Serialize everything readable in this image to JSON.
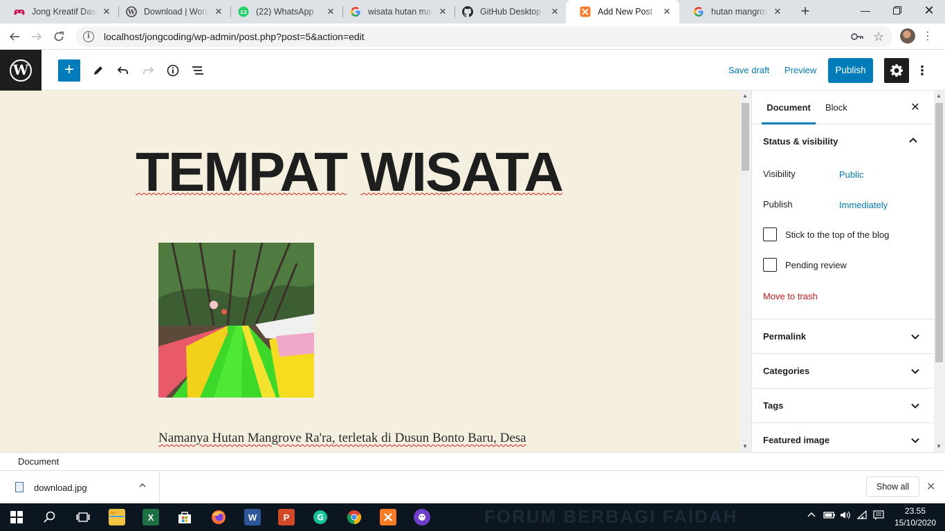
{
  "browser": {
    "tabs": [
      {
        "title": "Jong Kreatif Dashb",
        "icon": "game-controller-icon",
        "color": "#c2185b"
      },
      {
        "title": "Download | WordP",
        "icon": "wordpress-icon",
        "color": "#464342"
      },
      {
        "title": "(22) WhatsApp",
        "icon": "whatsapp-icon",
        "color": "#25d366",
        "badge": "22"
      },
      {
        "title": "wisata hutan mang",
        "icon": "google-icon",
        "color": "#4285f4"
      },
      {
        "title": "GitHub Desktop | S",
        "icon": "github-icon",
        "color": "#24292e"
      },
      {
        "title": "Add New Post ‹ la",
        "icon": "xampp-icon",
        "color": "#fb7a24",
        "active": true
      },
      {
        "title": "hutan mangrove je",
        "icon": "google-icon",
        "color": "#4285f4"
      }
    ],
    "url": "localhost/jongcoding/wp-admin/post.php?post=5&action=edit"
  },
  "wp_header": {
    "save_draft": "Save draft",
    "preview": "Preview",
    "publish": "Publish",
    "accent": "#007cba"
  },
  "post": {
    "title_word1": "TEMPAT",
    "title_word2": "WISATA",
    "paragraph": "Namanya Hutan Mangrove Ra'ra, terletak di Dusun Bonto Baru, Desa",
    "background": "#f5efe0"
  },
  "sidebar": {
    "tab_document": "Document",
    "tab_block": "Block",
    "status_title": "Status & visibility",
    "visibility_label": "Visibility",
    "visibility_value": "Public",
    "publish_label": "Publish",
    "publish_value": "Immediately",
    "sticky_label": "Stick to the top of the blog",
    "pending_label": "Pending review",
    "trash_label": "Move to trash",
    "panels": [
      "Permalink",
      "Categories",
      "Tags",
      "Featured image"
    ]
  },
  "footer": {
    "breadcrumb": "Document"
  },
  "downloads": {
    "file_name": "download.jpg",
    "show_all": "Show all"
  },
  "taskbar": {
    "time": "23.55",
    "date": "15/10/2020"
  }
}
